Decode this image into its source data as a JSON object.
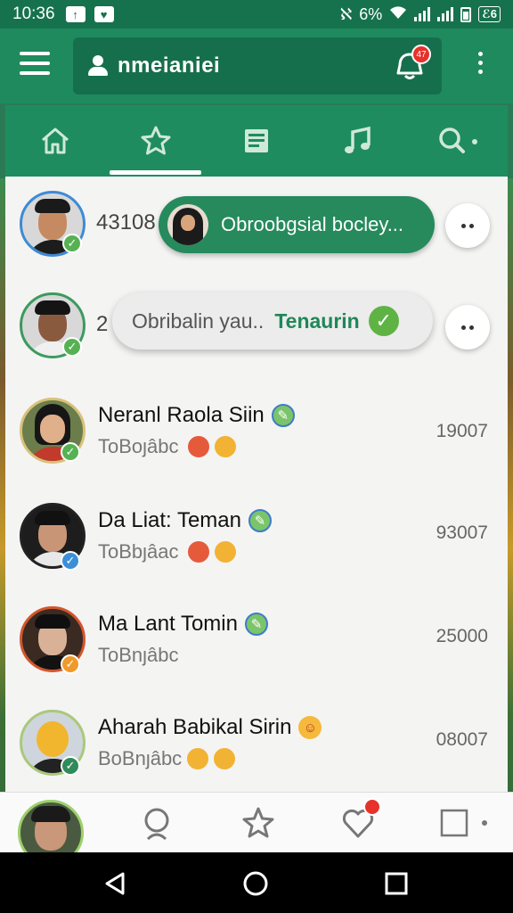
{
  "status_bar": {
    "time": "10:36",
    "battery_text": "6%",
    "right_box": "ℰ6"
  },
  "app_bar": {
    "account_name": "nmeianiei",
    "notification_badge": "47",
    "icons": [
      "menu-icon",
      "user-icon",
      "notification-icon",
      "more-vert-icon"
    ]
  },
  "tabs": [
    {
      "icon": "home-icon",
      "active": false
    },
    {
      "icon": "star-icon",
      "active": true
    },
    {
      "icon": "feed-icon",
      "active": false
    },
    {
      "icon": "music-icon",
      "active": false
    },
    {
      "icon": "search-icon",
      "active": false
    }
  ],
  "rows": [
    {
      "count": "43108",
      "bubble_text": "Obroobgsial bocley...",
      "badge": "✓"
    },
    {
      "count": "2",
      "bubble_text": "Obribalin yau..",
      "bubble_action": "Tenaurin",
      "badge": "✓"
    },
    {
      "name": "Neranl Raola Siin",
      "sub": "ToBoȷâbc",
      "number": "19007",
      "badge": "✓"
    },
    {
      "name": "Da Liat: Teman",
      "sub": "ToBbȷâac",
      "number": "93007",
      "badge": "✓"
    },
    {
      "name": "Ma Lant Tomin",
      "sub": "ToBnȷâbc",
      "number": "25000",
      "badge": "✓"
    },
    {
      "name": "Aharah Babikal Sirin",
      "sub": "BoBnȷâbc",
      "number": "08007",
      "badge": "✓"
    }
  ],
  "colors": {
    "primary": "#1e8a5e",
    "primary_dark": "#16724d",
    "accent_check": "#5fb345",
    "badge_red": "#e6312c"
  }
}
